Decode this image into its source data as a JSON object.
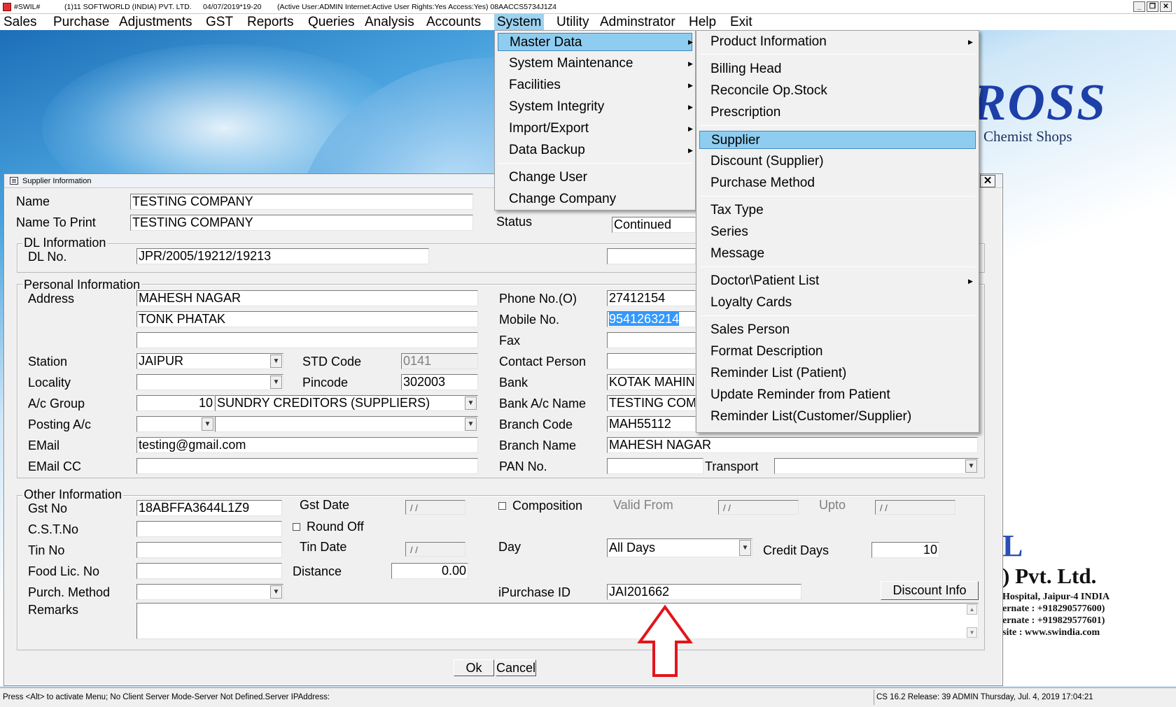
{
  "titlebar": {
    "app_code": "#SWIL#",
    "company": "(1)11 SOFTWORLD (INDIA) PVT. LTD.",
    "period": "04/07/2019*19-20",
    "status": "(Active User:ADMIN Internet:Active  User Rights:Yes Access:Yes) 08AACCS5734J1Z4",
    "minimize": "_",
    "restore": "❐",
    "close": "✕"
  },
  "menubar": {
    "items": [
      "Sales",
      "Purchase",
      "Adjustments",
      "GST",
      "Reports",
      "Queries",
      "Analysis",
      "Accounts",
      "System",
      "Utility",
      "Adminstrator",
      "Help",
      "Exit"
    ]
  },
  "background": {
    "brand": "ROSS",
    "tagline": "Chemist Shops",
    "brand_letter": "L",
    "company_name": ") Pvt. Ltd.",
    "address": "Hospital, Jaipur-4 INDIA",
    "phone1": "ernate : +918290577600)",
    "phone2": "ernate : +919829577601)",
    "website": "site : www.swindia.com"
  },
  "dialog": {
    "title": "Supplier Information",
    "close": "✕",
    "name_label": "Name",
    "name_value": "TESTING COMPANY",
    "name_to_print_label": "Name To Print",
    "name_to_print_value": "TESTING COMPANY",
    "status_label": "Status",
    "status_value": "Continued",
    "dl_group": "DL Information",
    "dl_no_label": "DL No.",
    "dl_no_value": "JPR/2005/19212/19213",
    "personal_group": "Personal Information",
    "address_label": "Address",
    "address_line1": "MAHESH NAGAR",
    "address_line2": "TONK PHATAK",
    "address_line3": "",
    "station_label": "Station",
    "station_value": "JAIPUR",
    "std_label": "STD Code",
    "std_value": "0141",
    "locality_label": "Locality",
    "locality_value": "",
    "pincode_label": "Pincode",
    "pincode_value": "302003",
    "ac_group_label": "A/c Group",
    "ac_group_code": "10",
    "ac_group_name": "SUNDRY CREDITORS (SUPPLIERS)",
    "posting_label": "Posting A/c",
    "email_label": "EMail",
    "email_value": "testing@gmail.com",
    "email_cc_label": "EMail CC",
    "phone_label": "Phone No.(O)",
    "phone_value": "27412154",
    "mobile_label": "Mobile No.",
    "mobile_value": "9541263214",
    "fax_label": "Fax",
    "contact_label": "Contact Person",
    "bank_label": "Bank",
    "bank_value": "KOTAK MAHINDRA",
    "bank_ac_name_label": "Bank A/c Name",
    "bank_ac_name_value": "TESTING COMPANY",
    "branch_code_label": "Branch Code",
    "branch_code_value": "MAH55112",
    "branch_name_label": "Branch Name",
    "branch_name_value": "MAHESH NAGAR",
    "pan_label": "PAN No.",
    "transport_label": "Transport",
    "other_group": "Other Information",
    "gst_no_label": "Gst No",
    "gst_no_value": "18ABFFA3644L1Z9",
    "gst_date_label": "Gst Date",
    "date_empty": "/ /",
    "composition_label": "Composition",
    "valid_from_label": "Valid From",
    "upto_label": "Upto",
    "cst_label": "C.S.T.No",
    "round_off_label": "Round Off",
    "tin_no_label": "Tin No",
    "tin_date_label": "Tin Date",
    "day_label": "Day",
    "day_value": "All Days",
    "credit_days_label": "Credit Days",
    "credit_days_value": "10",
    "food_lic_label": "Food Lic. No",
    "distance_label": "Distance",
    "distance_value": "0.00",
    "purch_method_label": "Purch. Method",
    "ipurchase_label": "iPurchase ID",
    "ipurchase_value": "JAI201662",
    "discount_info_btn": "Discount Info",
    "remarks_label": "Remarks",
    "ok_btn": "Ok",
    "cancel_btn": "Cancel"
  },
  "system_menu": {
    "items": [
      "Master Data",
      "System Maintenance",
      "Facilities",
      "System Integrity",
      "Import/Export",
      "Data Backup",
      "Change User",
      "Change Company"
    ]
  },
  "master_data_menu": {
    "items": [
      "Product Information",
      "Billing Head",
      "Reconcile Op.Stock",
      "Prescription",
      "Supplier",
      "Discount (Supplier)",
      "Purchase Method",
      "Tax Type",
      "Series",
      "Message",
      "Doctor\\Patient List",
      "Loyalty Cards",
      "Sales Person",
      "Format Description",
      "Reminder List (Patient)",
      "Update Reminder from Patient",
      "Reminder List(Customer/Supplier)"
    ]
  },
  "statusbar": {
    "left": "Press <Alt> to activate Menu; No Client Server Mode-Server Not Defined.Server IPAddress:",
    "right": "CS 16.2 Release: 39  ADMIN  Thursday, Jul.  4, 2019  17:04:21"
  },
  "colors": {
    "menu_highlight": "#8fcdf0",
    "selection": "#3399ff",
    "annotation_arrow": "#e3141b"
  }
}
